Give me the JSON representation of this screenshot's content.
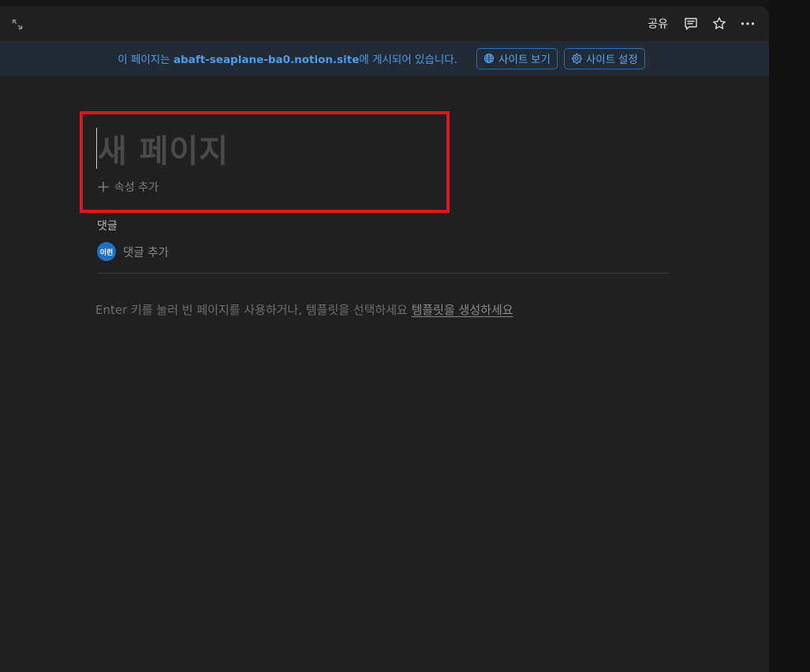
{
  "topbar": {
    "expand_icon": "expand-arrows-icon",
    "share_label": "공유",
    "comments_icon": "comment-icon",
    "favorite_icon": "star-icon",
    "more_icon": "more-horizontal-icon"
  },
  "banner": {
    "text_prefix": "이 페이지는 ",
    "domain": "abaft-seaplane-ba0.notion.site",
    "text_suffix": "에 게시되어 있습니다.",
    "view_site_label": "사이트 보기",
    "view_site_icon": "globe-icon",
    "site_settings_label": "사이트 설정",
    "site_settings_icon": "gear-icon"
  },
  "page": {
    "title_placeholder": "새 페이지",
    "add_property_label": "속성 추가",
    "comments_heading": "댓글",
    "avatar_initials": "이런",
    "add_comment_placeholder": "댓글 추가",
    "hint_text": "Enter 키를 눌러 빈 페이지를 사용하거나, 템플릿을 선택하세요 ",
    "hint_link": "템플릿을 생성하세요"
  },
  "colors": {
    "panel_bg": "#202020",
    "banner_bg": "#212a35",
    "accent_blue": "#4c9dea",
    "highlight_red": "#e0161e",
    "avatar_blue": "#1f6fc5"
  }
}
